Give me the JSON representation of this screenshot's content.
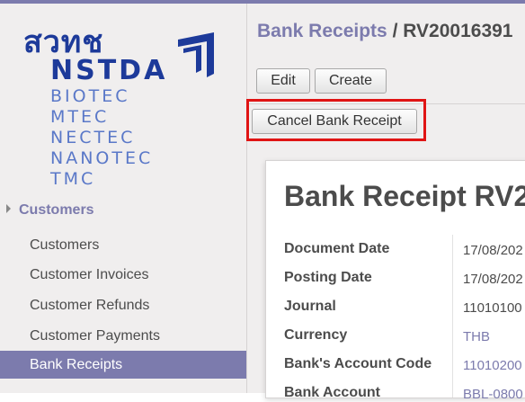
{
  "logo": {
    "thai_text": "สวทช",
    "nstda": "NSTDA",
    "units": [
      "BIOTEC",
      "MTEC",
      "NECTEC",
      "NANOTEC",
      "TMC"
    ]
  },
  "sidebar": {
    "section_label": "Customers",
    "items": [
      {
        "label": "Customers"
      },
      {
        "label": "Customer Invoices"
      },
      {
        "label": "Customer Refunds"
      },
      {
        "label": "Customer Payments"
      },
      {
        "label": "Bank Receipts"
      }
    ]
  },
  "breadcrumb": {
    "parent": "Bank Receipts",
    "separator": " / ",
    "current": "RV20016391"
  },
  "toolbar": {
    "edit_label": "Edit",
    "create_label": "Create",
    "cancel_label": "Cancel Bank Receipt"
  },
  "sheet": {
    "title": "Bank Receipt RV2",
    "fields": [
      {
        "label": "Document Date",
        "value": "17/08/202"
      },
      {
        "label": "Posting Date",
        "value": "17/08/202"
      },
      {
        "label": "Journal",
        "value": "11010100"
      },
      {
        "label": "Currency",
        "value": "THB"
      },
      {
        "label": "Bank's Account Code",
        "value": "11010200"
      },
      {
        "label": "Bank Account",
        "value": "BBL-0800"
      }
    ]
  },
  "colors": {
    "accent": "#7c7bad",
    "logo_blue": "#1d3a9a",
    "highlight": "#e01414"
  }
}
